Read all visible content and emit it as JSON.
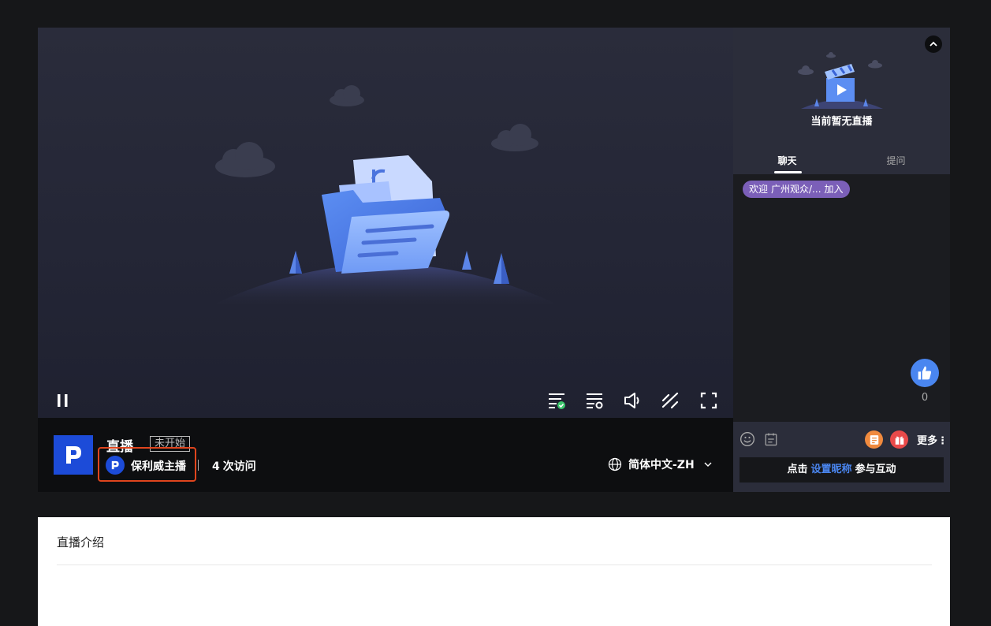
{
  "player": {
    "controls": [
      "pause-icon",
      "subtitle-check-icon",
      "playlist-settings-icon",
      "volume-icon",
      "line-switch-icon",
      "fullscreen-icon"
    ]
  },
  "info": {
    "title": "直播",
    "status": "未开始",
    "host_name": "保利威主播",
    "visits_count": "4",
    "visits_label": "次访问",
    "language": "简体中文-ZH"
  },
  "side": {
    "no_live_text": "当前暂无直播",
    "tabs": [
      {
        "label": "聊天",
        "active": true
      },
      {
        "label": "提问",
        "active": false
      }
    ],
    "welcome": {
      "prefix": "欢迎",
      "name": "广州观众/...",
      "suffix": "加入"
    },
    "like_count": "0",
    "more_label": "更多",
    "chat_input": {
      "prefix": "点击",
      "link": "设置昵称",
      "suffix": "参与互动"
    }
  },
  "intro": {
    "title": "直播介绍"
  },
  "colors": {
    "accent": "#4a86f0",
    "brand_blue": "#1c4bd8",
    "highlight_border": "#e0451d",
    "welcome_bg": "#7b5fb8"
  }
}
